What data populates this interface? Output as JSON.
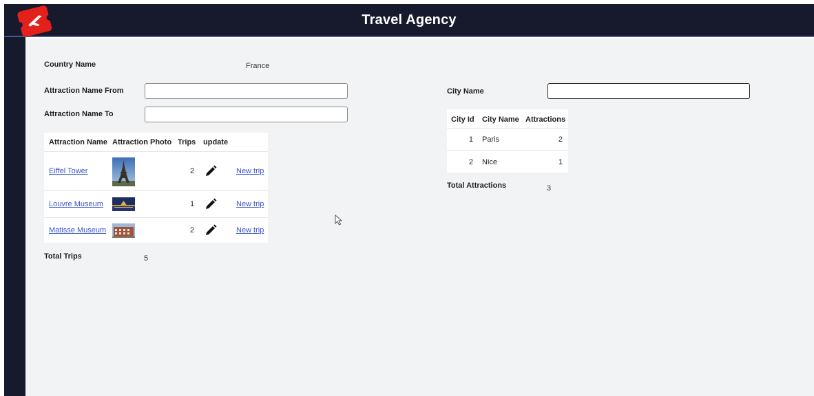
{
  "header": {
    "title": "Travel Agency",
    "logo_icon": "airplane-ticket-icon"
  },
  "country": {
    "label": "Country Name",
    "value": "France"
  },
  "filters": {
    "from_label": "Attraction Name From",
    "from_value": "",
    "to_label": "Attraction Name To",
    "to_value": "",
    "city_label": "City Name",
    "city_value": ""
  },
  "attractions": {
    "columns": [
      "Attraction Name",
      "Attraction Photo",
      "Trips",
      "update"
    ],
    "rows": [
      {
        "name": "Eiffel Tower",
        "photo": "eiffel-tower-photo",
        "trips": "2",
        "action": "New trip"
      },
      {
        "name": "Louvre Museum",
        "photo": "louvre-museum-photo",
        "trips": "1",
        "action": "New trip"
      },
      {
        "name": "Matisse Museum",
        "photo": "matisse-museum-photo",
        "trips": "2",
        "action": "New trip"
      }
    ],
    "total_label": "Total Trips",
    "total_value": "5"
  },
  "cities": {
    "columns": [
      "City Id",
      "City Name",
      "Attractions"
    ],
    "rows": [
      {
        "id": "1",
        "name": "Paris",
        "attractions": "2"
      },
      {
        "id": "2",
        "name": "Nice",
        "attractions": "1"
      }
    ],
    "total_label": "Total Attractions",
    "total_value": "3"
  },
  "colors": {
    "header_bg": "#161a2c",
    "logo_red": "#e3201b",
    "link": "#3a55c9",
    "page_bg": "#f2f3f5"
  }
}
